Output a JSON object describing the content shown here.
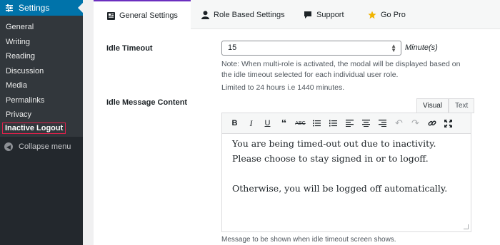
{
  "sidebar": {
    "header": "Settings",
    "header_icon": "sliders-icon",
    "items": [
      {
        "label": "General"
      },
      {
        "label": "Writing"
      },
      {
        "label": "Reading"
      },
      {
        "label": "Discussion"
      },
      {
        "label": "Media"
      },
      {
        "label": "Permalinks"
      },
      {
        "label": "Privacy"
      },
      {
        "label": "Inactive Logout"
      }
    ],
    "collapse_label": "Collapse menu"
  },
  "tabs": [
    {
      "label": "General Settings",
      "icon": "grid-icon"
    },
    {
      "label": "Role Based Settings",
      "icon": "user-icon"
    },
    {
      "label": "Support",
      "icon": "chat-icon"
    },
    {
      "label": "Go Pro",
      "icon": "star-icon"
    }
  ],
  "idle_timeout": {
    "label": "Idle Timeout",
    "value": "15",
    "unit": "Minute(s)",
    "note1": "Note: When multi-role is activated, the modal will be displayed based on the idle timeout selected for each individual user role.",
    "note2": "Limited to 24 hours i.e 1440 minutes."
  },
  "idle_message": {
    "label": "Idle Message Content",
    "tab_visual": "Visual",
    "tab_text": "Text",
    "line1": "You are being timed-out out due to inactivity. Please choose to stay signed in or to logoff.",
    "line2": "Otherwise, you will be logged off automatically.",
    "hint": "Message to be shown when idle timeout screen shows."
  },
  "colors": {
    "sidebar_bg": "#23282d",
    "accent_blue": "#0073aa",
    "tab_accent": "#6b2fbf",
    "highlight_border": "#e0214b",
    "star": "#f0b400"
  }
}
